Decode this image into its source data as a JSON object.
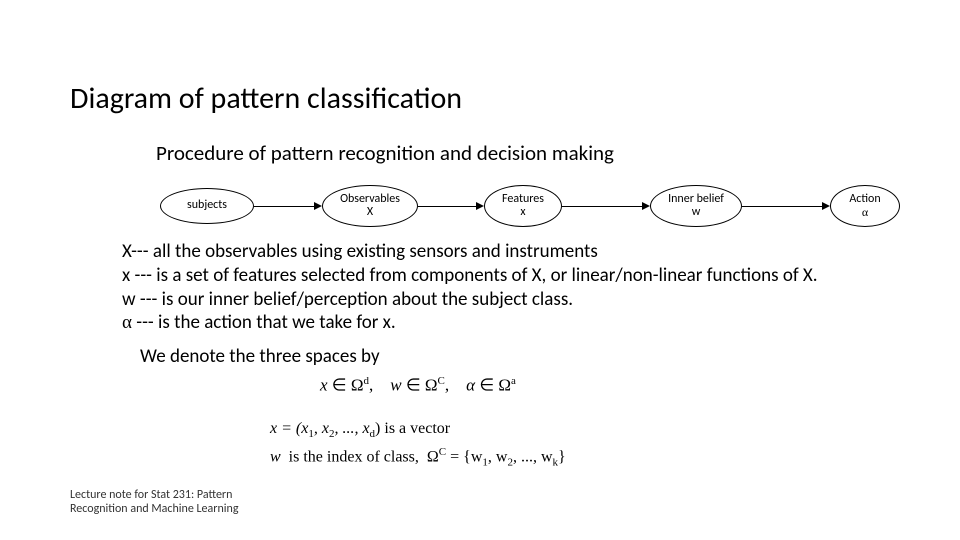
{
  "title": "Diagram of pattern classification",
  "subtitle": "Procedure of pattern recognition and decision making",
  "nodes": {
    "subjects": "subjects",
    "obs_l1": "Observables",
    "obs_l2": "X",
    "feat_l1": "Features",
    "feat_l2": "x",
    "belief_l1": "Inner belief",
    "belief_l2": "w",
    "action_l1": "Action",
    "action_l2": "α"
  },
  "bullets": {
    "l1": "X--- all the observables using existing sensors and instruments",
    "l2": "x  --- is a set of features selected from components of X, or linear/non-linear functions of X.",
    "l3": "w --- is our inner belief/perception about the subject class.",
    "l4a": "α",
    "l4b": " --- is the action that we take for x."
  },
  "denote": "We denote the three spaces by",
  "math": {
    "line1_html": "x ∈ Ω<sup>d</sup>,   w ∈ Ω<sup>C</sup>,   α ∈ Ω<sup>a</sup>",
    "line2_pre": "x = (x",
    "line2_mid": ", x",
    "line2_post": ", ..., x",
    "line2_end": ")  is a vector",
    "line3_pre": "w  is the index of class,  Ω",
    "line3_set": " = {w",
    "line3_mid": ", w",
    "line3_post": ", ..., w",
    "line3_end": "}",
    "sub1": "1",
    "sub2": "2",
    "subd": "d",
    "subk": "k",
    "supc": "C"
  },
  "footer": {
    "l1": "Lecture note for Stat 231: Pattern",
    "l2": "Recognition and Machine Learning"
  }
}
